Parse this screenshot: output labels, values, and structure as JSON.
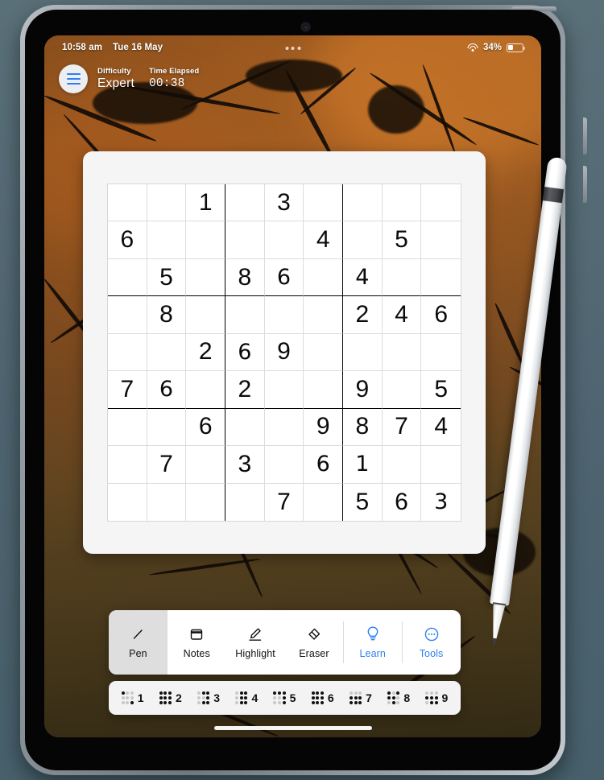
{
  "status_bar": {
    "time": "10:58 am",
    "date": "Tue 16 May",
    "battery_percent": "34%",
    "battery_level": 34,
    "wifi_icon": "wifi-icon",
    "battery_icon": "battery-icon"
  },
  "header": {
    "menu_icon": "hamburger-menu-icon",
    "difficulty_label": "Difficulty",
    "difficulty_value": "Expert",
    "time_label": "Time Elapsed",
    "time_value": "00:38"
  },
  "board": {
    "rows": [
      [
        "",
        "",
        "1",
        "",
        "3",
        "",
        "",
        "",
        ""
      ],
      [
        "6",
        "",
        "",
        "",
        "",
        "4",
        "",
        "5",
        ""
      ],
      [
        "",
        "5",
        "",
        "8",
        "6",
        "",
        "4",
        "",
        ""
      ],
      [
        "",
        "8",
        "",
        "",
        "",
        "",
        "2",
        "4",
        "6"
      ],
      [
        "",
        "",
        "2",
        "6",
        "9",
        "",
        "",
        "",
        ""
      ],
      [
        "7",
        "6",
        "",
        "2",
        "",
        "",
        "9",
        "",
        "5"
      ],
      [
        "",
        "",
        "6",
        "",
        "",
        "9",
        "8",
        "7",
        "4"
      ],
      [
        "",
        "7",
        "",
        "3",
        "",
        "6",
        "1",
        "",
        ""
      ],
      [
        "",
        "",
        "",
        "",
        "7",
        "",
        "5",
        "6",
        "3"
      ]
    ],
    "handwritten": [
      [
        false,
        false,
        false,
        false,
        false,
        false,
        false,
        false,
        false
      ],
      [
        false,
        false,
        false,
        false,
        false,
        false,
        false,
        false,
        false
      ],
      [
        false,
        false,
        false,
        false,
        true,
        false,
        true,
        false,
        false
      ],
      [
        false,
        false,
        false,
        false,
        false,
        false,
        false,
        false,
        false
      ],
      [
        false,
        false,
        false,
        true,
        false,
        false,
        false,
        false,
        false
      ],
      [
        false,
        true,
        false,
        false,
        false,
        false,
        false,
        false,
        false
      ],
      [
        false,
        false,
        false,
        false,
        false,
        false,
        false,
        false,
        false
      ],
      [
        false,
        false,
        false,
        false,
        false,
        true,
        true,
        false,
        false
      ],
      [
        false,
        false,
        false,
        false,
        false,
        false,
        false,
        false,
        true
      ]
    ]
  },
  "toolbar": {
    "items": [
      {
        "label": "Pen",
        "icon": "pen-icon",
        "active": true,
        "accent": false
      },
      {
        "label": "Notes",
        "icon": "notes-icon",
        "active": false,
        "accent": false
      },
      {
        "label": "Highlight",
        "icon": "highlighter-icon",
        "active": false,
        "accent": false
      },
      {
        "label": "Eraser",
        "icon": "eraser-icon",
        "active": false,
        "accent": false
      },
      {
        "label": "Learn",
        "icon": "lightbulb-icon",
        "active": false,
        "accent": true
      },
      {
        "label": "Tools",
        "icon": "more-circle-icon",
        "active": false,
        "accent": true
      }
    ]
  },
  "number_pad": {
    "keys": [
      {
        "number": "1",
        "dots": [
          1,
          0,
          0,
          0,
          0,
          0,
          0,
          0,
          1
        ]
      },
      {
        "number": "2",
        "dots": [
          1,
          1,
          1,
          1,
          1,
          1,
          1,
          1,
          1
        ]
      },
      {
        "number": "3",
        "dots": [
          0,
          1,
          1,
          0,
          0,
          1,
          0,
          1,
          1
        ]
      },
      {
        "number": "4",
        "dots": [
          0,
          1,
          1,
          0,
          1,
          1,
          0,
          1,
          1
        ]
      },
      {
        "number": "5",
        "dots": [
          1,
          1,
          1,
          0,
          0,
          1,
          0,
          0,
          1
        ]
      },
      {
        "number": "6",
        "dots": [
          1,
          1,
          1,
          1,
          1,
          1,
          1,
          1,
          1
        ]
      },
      {
        "number": "7",
        "dots": [
          0,
          0,
          0,
          1,
          1,
          1,
          1,
          1,
          1
        ]
      },
      {
        "number": "8",
        "dots": [
          1,
          0,
          1,
          1,
          1,
          0,
          0,
          1,
          0
        ]
      },
      {
        "number": "9",
        "dots": [
          0,
          0,
          0,
          1,
          1,
          1,
          0,
          1,
          1
        ]
      }
    ]
  },
  "colors": {
    "accent_blue": "#2f7ff0",
    "active_tool_bg": "#dedede",
    "card_bg": "#f5f5f6",
    "wallpaper_top": "#8a5320",
    "wallpaper_bottom": "#332a14"
  }
}
